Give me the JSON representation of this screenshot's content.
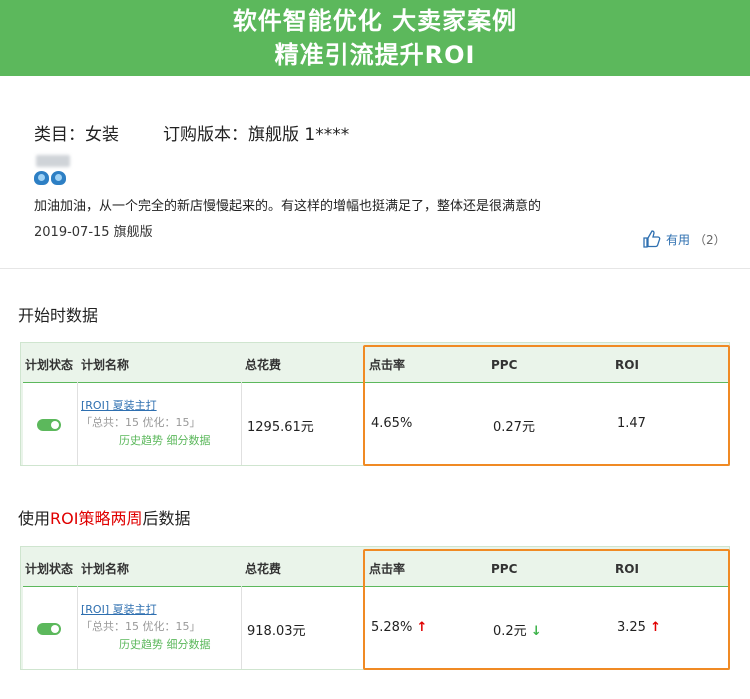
{
  "banner": {
    "line1": "软件智能优化  大卖家案例",
    "line2": "精准引流提升ROI"
  },
  "review": {
    "category": "类目：女装",
    "version": "订购版本：旗舰版 1****",
    "comment": "加油加油，从一个完全的新店慢慢起来的。有这样的增幅也挺满足了，整体还是很满意的",
    "date": "2019-07-15 旗舰版",
    "useful_label": "有用",
    "useful_count": "（2）"
  },
  "before": {
    "title": "开始时数据",
    "headers": [
      "计划状态",
      "计划名称",
      "总花费",
      "点击率",
      "PPC",
      "ROI"
    ],
    "plan_name": "[ROI] 夏装主打",
    "plan_meta": "「总共：15  优化：15」",
    "plan_links": "历史趋势 细分数据",
    "cost": "1295.61元",
    "ctr": "4.65%",
    "ppc": "0.27元",
    "roi": "1.47"
  },
  "after": {
    "title_prefix": "使用",
    "title_highlight": "ROI策略两周",
    "title_suffix": "后数据",
    "headers": [
      "计划状态",
      "计划名称",
      "总花费",
      "点击率",
      "PPC",
      "ROI"
    ],
    "plan_name": "[ROI] 夏装主打",
    "plan_meta": "「总共：15  优化：15」",
    "plan_links": "历史趋势 细分数据",
    "cost": "918.03元",
    "ctr": "5.28%",
    "ppc": "0.2元",
    "roi": "3.25"
  },
  "colors": {
    "accent_green": "#5cb85c",
    "highlight_orange": "#f08a24",
    "up_red": "#e00000",
    "down_green": "#3cb34a"
  }
}
